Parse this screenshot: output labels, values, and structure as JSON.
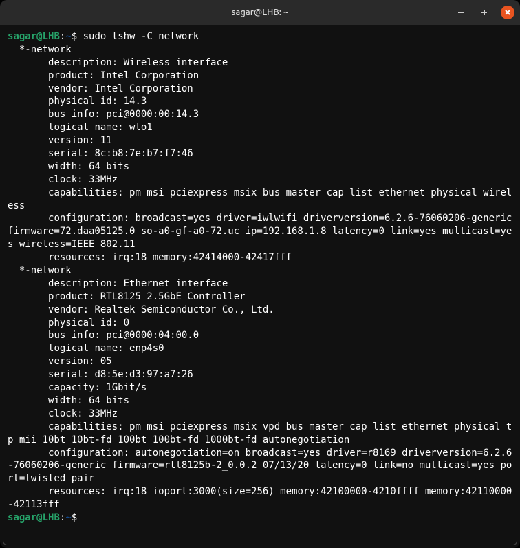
{
  "titlebar": {
    "title": "sagar@LHB: ~"
  },
  "prompt": {
    "user": "sagar",
    "at": "@",
    "host": "LHB",
    "colon": ":",
    "path": "~",
    "dollar": "$ "
  },
  "command": "sudo lshw -C network",
  "output": {
    "l0": "  *-network",
    "l1": "       description: Wireless interface",
    "l2": "       product: Intel Corporation",
    "l3": "       vendor: Intel Corporation",
    "l4": "       physical id: 14.3",
    "l5": "       bus info: pci@0000:00:14.3",
    "l6": "       logical name: wlo1",
    "l7": "       version: 11",
    "l8": "       serial: 8c:b8:7e:b7:f7:46",
    "l9": "       width: 64 bits",
    "l10": "       clock: 33MHz",
    "l11": "       capabilities: pm msi pciexpress msix bus_master cap_list ethernet physical wireless",
    "l12": "       configuration: broadcast=yes driver=iwlwifi driverversion=6.2.6-76060206-generic firmware=72.daa05125.0 so-a0-gf-a0-72.uc ip=192.168.1.8 latency=0 link=yes multicast=yes wireless=IEEE 802.11",
    "l13": "       resources: irq:18 memory:42414000-42417fff",
    "l14": "  *-network",
    "l15": "       description: Ethernet interface",
    "l16": "       product: RTL8125 2.5GbE Controller",
    "l17": "       vendor: Realtek Semiconductor Co., Ltd.",
    "l18": "       physical id: 0",
    "l19": "       bus info: pci@0000:04:00.0",
    "l20": "       logical name: enp4s0",
    "l21": "       version: 05",
    "l22": "       serial: d8:5e:d3:97:a7:26",
    "l23": "       capacity: 1Gbit/s",
    "l24": "       width: 64 bits",
    "l25": "       clock: 33MHz",
    "l26": "       capabilities: pm msi pciexpress msix vpd bus_master cap_list ethernet physical tp mii 10bt 10bt-fd 100bt 100bt-fd 1000bt-fd autonegotiation",
    "l27": "       configuration: autonegotiation=on broadcast=yes driver=r8169 driverversion=6.2.6-76060206-generic firmware=rtl8125b-2_0.0.2 07/13/20 latency=0 link=no multicast=yes port=twisted pair",
    "l28": "       resources: irq:18 ioport:3000(size=256) memory:42100000-4210ffff memory:42110000-42113fff"
  }
}
